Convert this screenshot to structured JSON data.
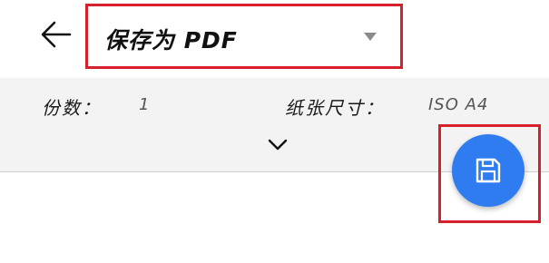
{
  "header": {
    "back_icon": "arrow-left-icon",
    "printer": {
      "selected": "保存为 PDF",
      "caret_icon": "triangle-down-icon"
    }
  },
  "options": {
    "copies": {
      "label": "份数：",
      "value": "1"
    },
    "paper_size": {
      "label": "纸张尺寸：",
      "value": "ISO A4"
    },
    "expand_icon": "chevron-down-icon"
  },
  "save_button": {
    "icon": "floppy-disk-icon",
    "color": "#2f7cf0"
  },
  "highlight_color": "#d6202a"
}
